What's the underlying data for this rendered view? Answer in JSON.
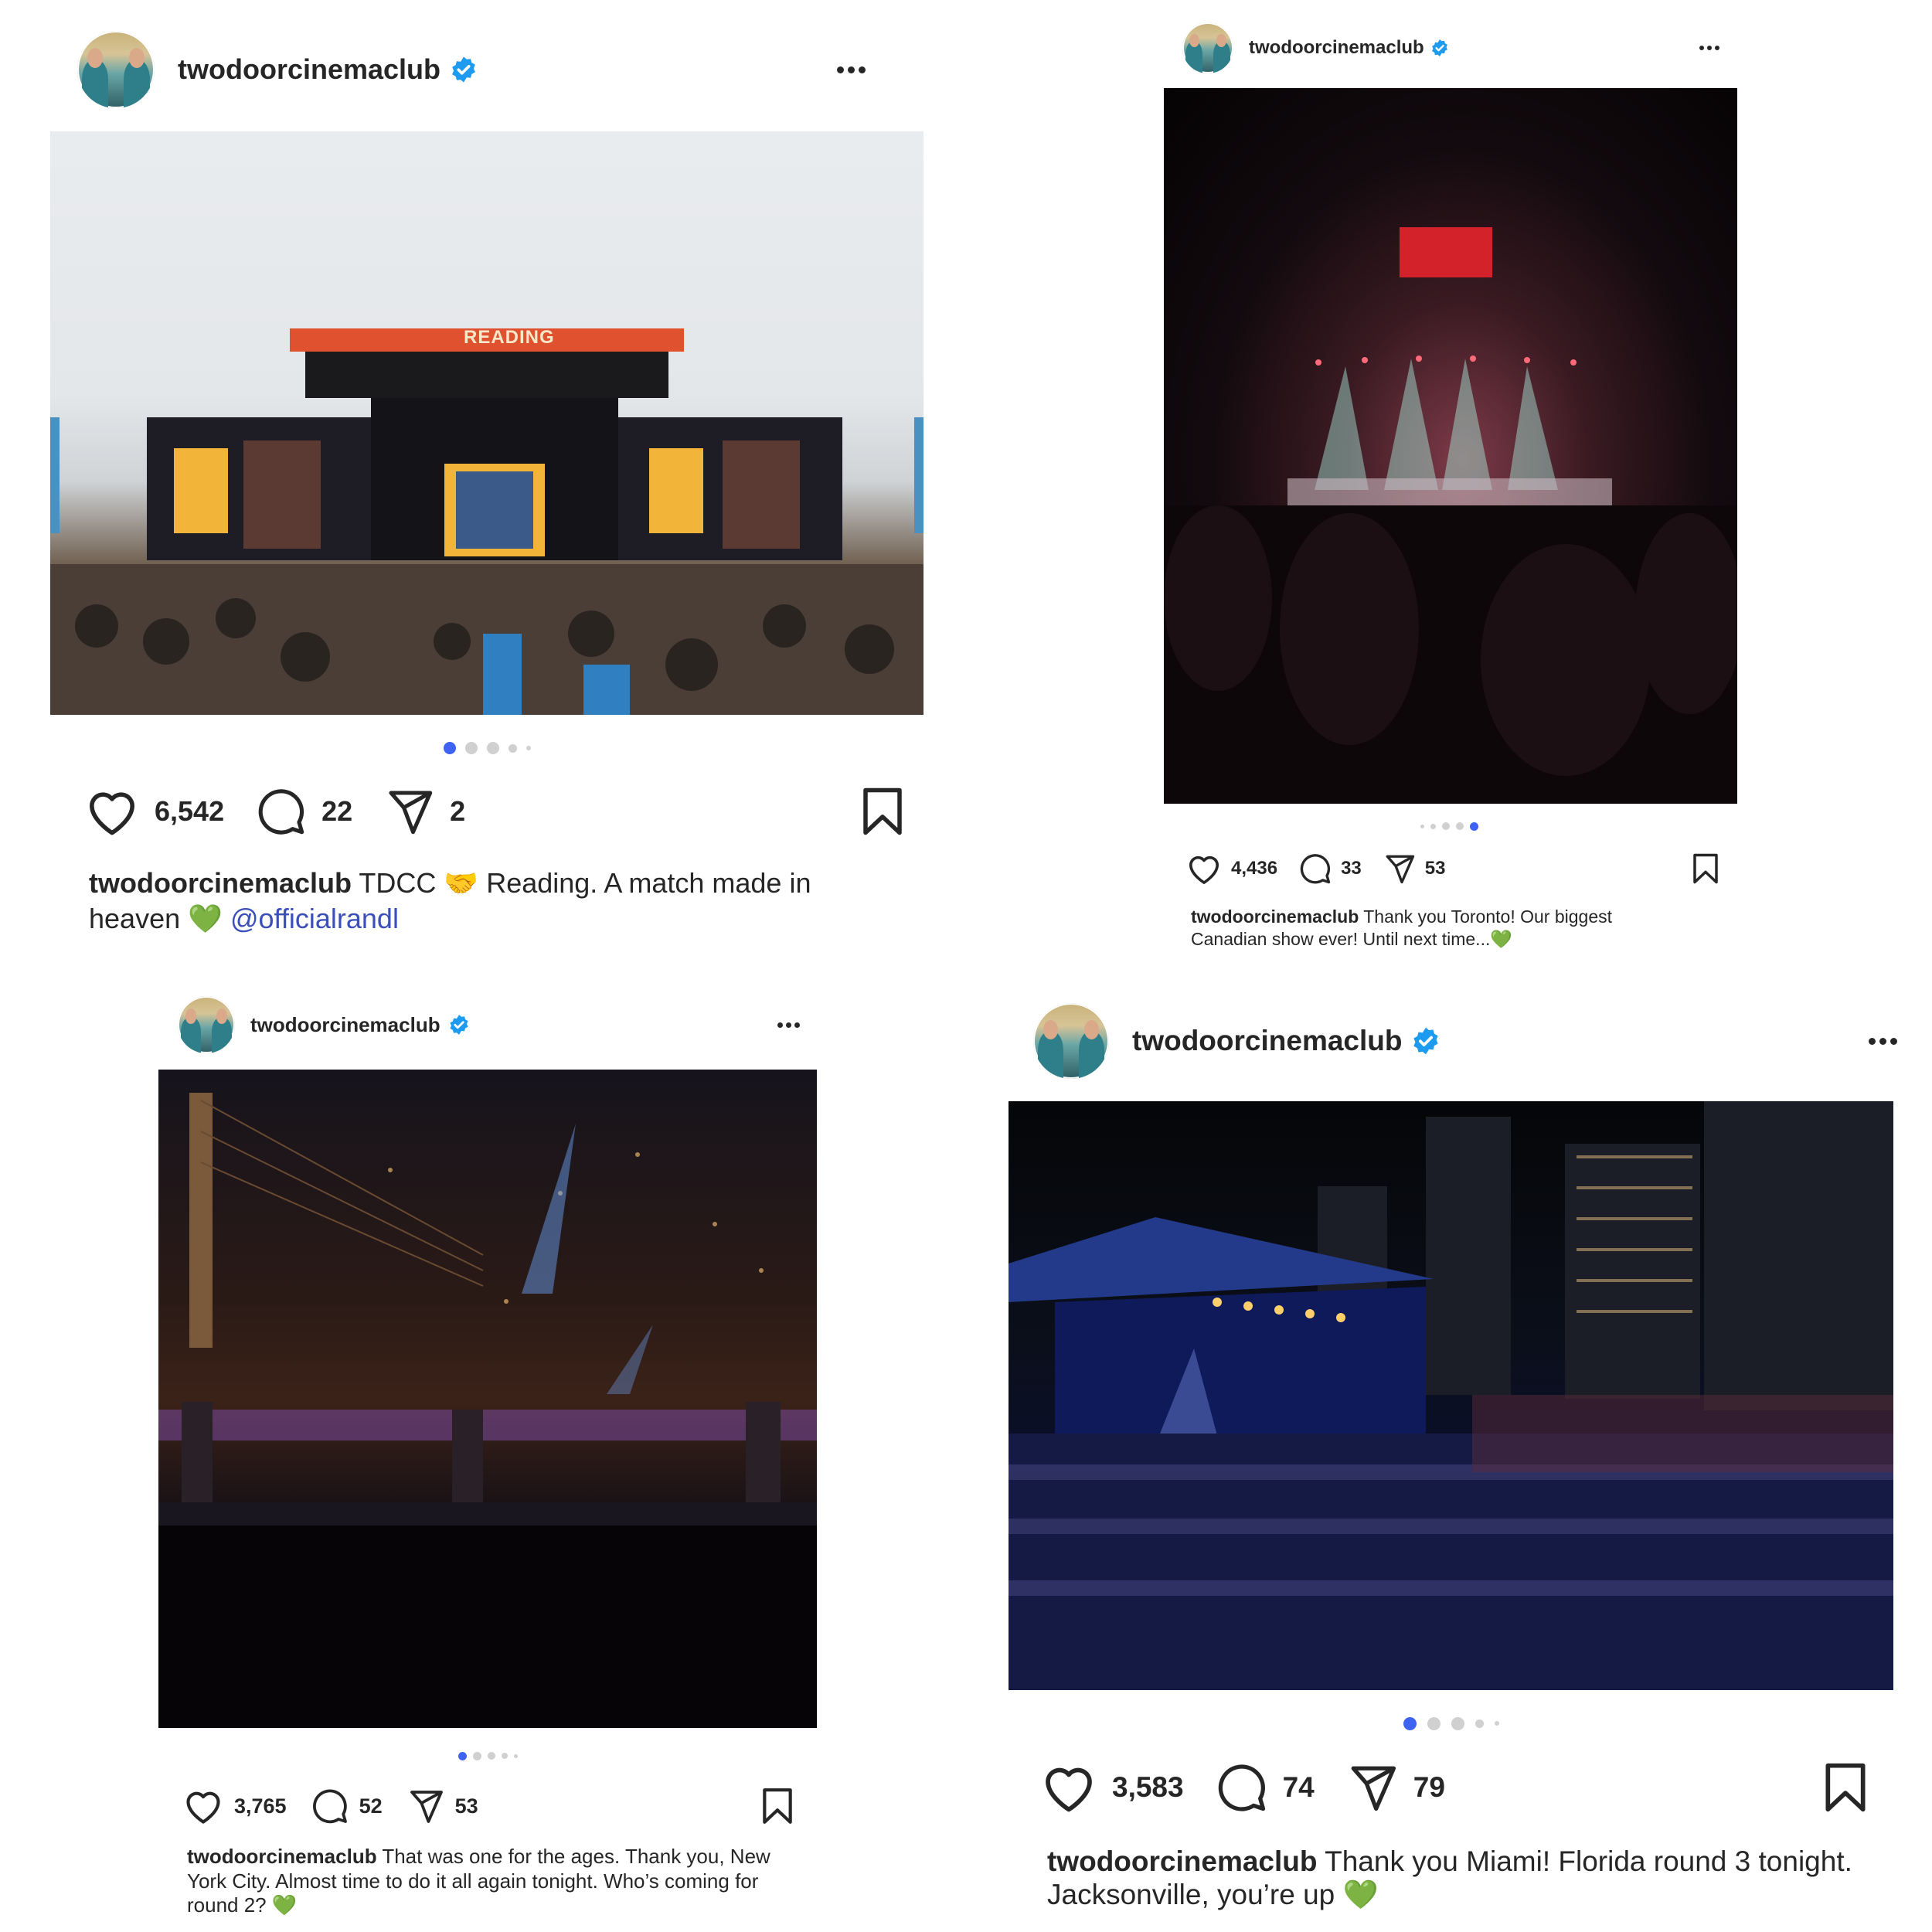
{
  "posts": [
    {
      "username": "twodoorcinemaclub",
      "likes": "6,542",
      "comments": "22",
      "shares": "2",
      "caption_user": "twodoorcinemaclub",
      "caption_text": "TDCC 🤝 Reading. A match made in heaven 💚",
      "caption_mention": "@officialrandl",
      "stage_banner": "READING",
      "carousel": {
        "count": 5,
        "active": 0
      }
    },
    {
      "username": "twodoorcinemaclub",
      "likes": "4,436",
      "comments": "33",
      "shares": "53",
      "caption_user": "twodoorcinemaclub",
      "caption_text": "Thank you Toronto! Our biggest Canadian show ever! Until next time...💚",
      "carousel": {
        "count": 5,
        "active": 4
      }
    },
    {
      "username": "twodoorcinemaclub",
      "likes": "3,765",
      "comments": "52",
      "shares": "53",
      "caption_user": "twodoorcinemaclub",
      "caption_text": "That was one for the ages. Thank you, New York City. Almost time to do it all again tonight. Who’s coming for round 2? 💚",
      "carousel": {
        "count": 5,
        "active": 0
      }
    },
    {
      "username": "twodoorcinemaclub",
      "likes": "3,583",
      "comments": "74",
      "shares": "79",
      "caption_user": "twodoorcinemaclub",
      "caption_text": "Thank you Miami! Florida round 3 tonight. Jacksonville, you’re up 💚",
      "carousel": {
        "count": 5,
        "active": 0
      }
    }
  ],
  "icons": {
    "like": "heart-icon",
    "comment": "comment-icon",
    "share": "paper-plane-icon",
    "save": "bookmark-icon",
    "verified": "verified-badge-icon",
    "more": "more-options-icon"
  },
  "colors": {
    "verified": "#1d9bf0",
    "active_dot": "#3e63f2",
    "mention": "#3b4fb8",
    "text": "#262626"
  }
}
